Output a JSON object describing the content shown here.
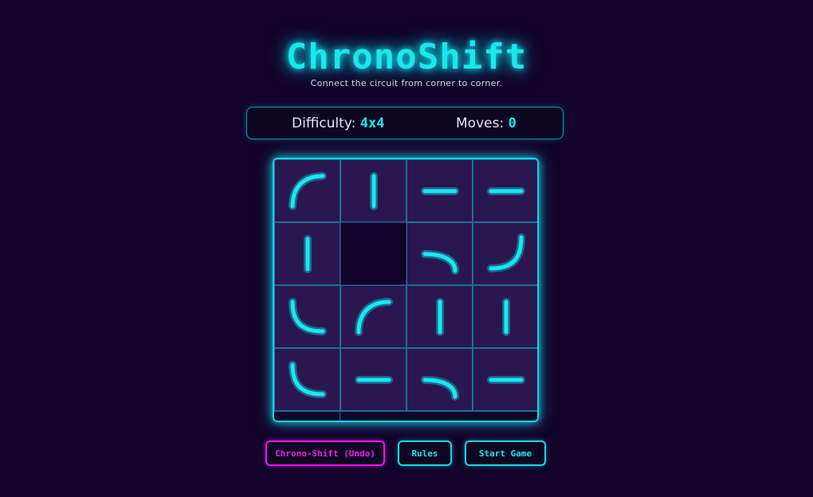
{
  "game": {
    "title": "ChronoShift",
    "subtitle": "Connect the circuit from corner to corner."
  },
  "status": {
    "difficulty_label": "Difficulty:",
    "difficulty_value": "4x4",
    "moves_label": "Moves:",
    "moves_value": "0"
  },
  "board": {
    "rows": 4,
    "cols": 4,
    "tiles": [
      [
        "curve-down-right",
        "straight-vertical",
        "straight-horizontal",
        "straight-horizontal"
      ],
      [
        "straight-vertical",
        "empty",
        "curve-left-down",
        "curve-up-left"
      ],
      [
        "curve-up-right",
        "curve-down-right",
        "straight-vertical",
        "straight-vertical"
      ],
      [
        "curve-up-right",
        "straight-horizontal",
        "curve-left-down",
        "straight-horizontal"
      ]
    ],
    "colors": {
      "pipe": "#19e8ec",
      "glow": "#12c8d8",
      "tile": "#2a1750",
      "empty": "#11042a"
    }
  },
  "buttons": {
    "undo_label": "Chrono-Shift (Undo)",
    "rules_label": "Rules",
    "start_label": "Start Game"
  },
  "colors": {
    "background": "#13022a",
    "accent_cyan": "#19e8ec",
    "accent_magenta": "#f01cf0"
  }
}
